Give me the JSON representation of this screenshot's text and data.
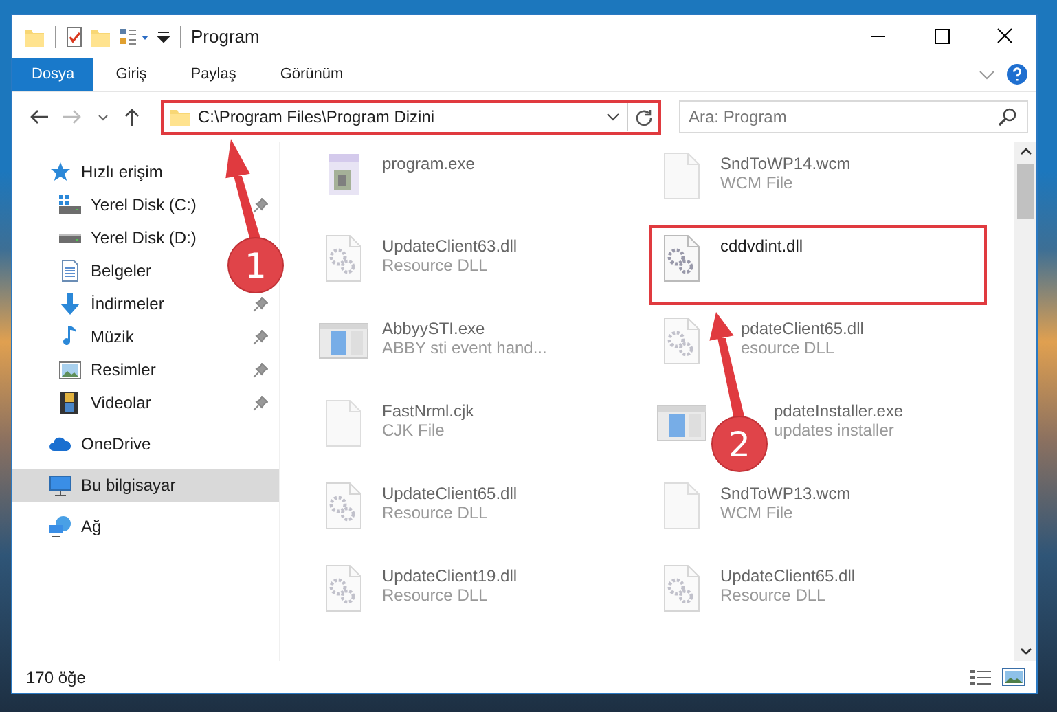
{
  "window": {
    "title": "Program"
  },
  "ribbon": {
    "tabs": [
      {
        "label": "Dosya",
        "selected": true
      },
      {
        "label": "Giriş",
        "selected": false
      },
      {
        "label": "Paylaş",
        "selected": false
      },
      {
        "label": "Görünüm",
        "selected": false
      }
    ]
  },
  "address_bar": {
    "path": "C:\\Program Files\\Program Dizini",
    "highlighted": true,
    "forward_disabled": true
  },
  "search": {
    "placeholder": "Ara: Program"
  },
  "sidebar": {
    "items": [
      {
        "label": "Hızlı erişim",
        "kind": "star",
        "selected": false,
        "children": [
          {
            "label": "Yerel Disk (C:)",
            "kind": "system-drive",
            "pinned": true
          },
          {
            "label": "Yerel Disk (D:)",
            "kind": "drive",
            "pinned": false
          },
          {
            "label": "Belgeler",
            "kind": "document",
            "pinned": false
          },
          {
            "label": "İndirmeler",
            "kind": "download",
            "pinned": true
          },
          {
            "label": "Müzik",
            "kind": "music",
            "pinned": true
          },
          {
            "label": "Resimler",
            "kind": "pictures",
            "pinned": true
          },
          {
            "label": "Videolar",
            "kind": "videos",
            "pinned": true
          }
        ]
      },
      {
        "label": "OneDrive",
        "kind": "cloud",
        "selected": false
      },
      {
        "label": "Bu bilgisayar",
        "kind": "computer",
        "selected": true
      },
      {
        "label": "Ağ",
        "kind": "network",
        "selected": false
      }
    ]
  },
  "files": [
    {
      "name": "program.exe",
      "kind": "program",
      "highlighted": false
    },
    {
      "name": "SndToWP14.wcm",
      "type": "WCM File",
      "kind": "blank",
      "highlighted": false
    },
    {
      "name": "UpdateClient63.dll",
      "type": "Resource DLL",
      "kind": "gears",
      "highlighted": false
    },
    {
      "name": "cddvdint.dll",
      "kind": "gears",
      "highlighted": true
    },
    {
      "name": "AbbyySTI.exe",
      "type": "ABBY sti event hand...",
      "kind": "window",
      "highlighted": false
    },
    {
      "name": "pdateClient65.dll",
      "type": "esource DLL",
      "kind": "gears",
      "highlighted": false
    },
    {
      "name": "FastNrml.cjk",
      "type": "CJK File",
      "kind": "blank",
      "highlighted": false
    },
    {
      "name": "pdateInstaller.exe",
      "type": "updates installer",
      "kind": "window",
      "highlighted": false
    },
    {
      "name": "UpdateClient65.dll",
      "type": "Resource DLL",
      "kind": "gears",
      "highlighted": false
    },
    {
      "name": "SndToWP13.wcm",
      "type": "WCM File",
      "kind": "blank",
      "highlighted": false
    },
    {
      "name": "UpdateClient19.dll",
      "type": "Resource DLL",
      "kind": "gears",
      "highlighted": false
    },
    {
      "name": "UpdateClient65.dll",
      "type": "Resource DLL",
      "kind": "gears",
      "highlighted": false
    }
  ],
  "status_bar": {
    "count": "170 öğe"
  },
  "annotations": [
    {
      "label": "1"
    },
    {
      "label": "2"
    }
  ]
}
